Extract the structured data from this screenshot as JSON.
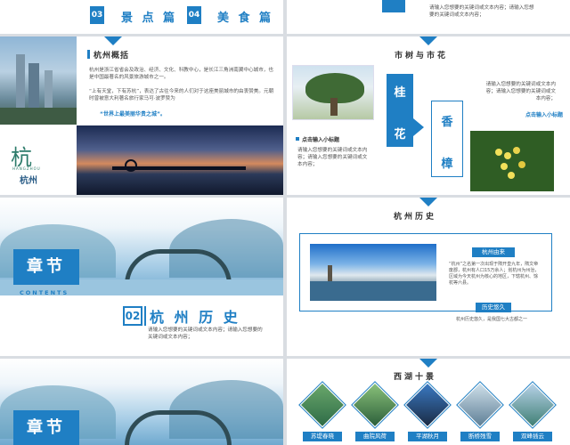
{
  "slide1": {
    "num1": "03",
    "label1": "景 点 篇",
    "num2": "04",
    "label2": "美 食 篇"
  },
  "slide2": {
    "text": "请输入您想要的关键词或文本内容；请输入您想要的关键词或文本内容；"
  },
  "slide3": {
    "title": "杭州概括",
    "para1": "杭州是浙江省省会及政治、经济、文化、科教中心，是长江三角洲南翼中心城市，也是中国最著名的风景旅游城市之一。",
    "para2": "“上有天堂，下有苏杭”，表达了古往今来的人们对于这座美丽城市的由衷赞美。元朝时曾被意大利著名旅行家马可·波罗赞为",
    "para3": "“世界上最美丽华贵之城”。",
    "logo_pinyin": "HANGZHOU",
    "logo_name": "杭州"
  },
  "slide4": {
    "title": "市树与市花",
    "box1a": "桂",
    "box1b": "花",
    "box2a": "香",
    "box2b": "樟",
    "text_right": "请输入您想要的关键词或文本内容；请输入您想要的关键词或文本内容；",
    "subtitle_right": "点击输入小标题",
    "subtitle_left": "点击输入小标题",
    "text_left": "请输入您想要的关键词或文本内容；请输入您想要的关键词或文本内容；"
  },
  "slide5": {
    "label": "章节",
    "sub": "CONTENTS",
    "num": "02",
    "title": "杭 州 历 史",
    "text": "请输入您想要的关键词或文本内容；请输入您想要的关键词或文本内容；"
  },
  "slide6": {
    "title": "杭州历史",
    "tag1": "杭州由来",
    "para1": "“杭州”之名第一次出现于隋开皇九年，隋文帝废郡，杭州有人口15万余人；划杭州为州治，区域为今天杭州为核心的地区，下辖杭州、馀杭等六县。",
    "tag2": "历史悠久",
    "para2": "杭州历史悠久，是我国七大古都之一"
  },
  "slide7": {
    "label": "章节"
  },
  "slide8": {
    "title": "西湖十景",
    "captions": [
      "苏堤春晓",
      "曲院风荷",
      "平湖秋月",
      "断桥残雪",
      "双峰插云"
    ]
  },
  "colors": {
    "accent": "#1f7fc4",
    "accent_light": "#5ea8d9"
  }
}
